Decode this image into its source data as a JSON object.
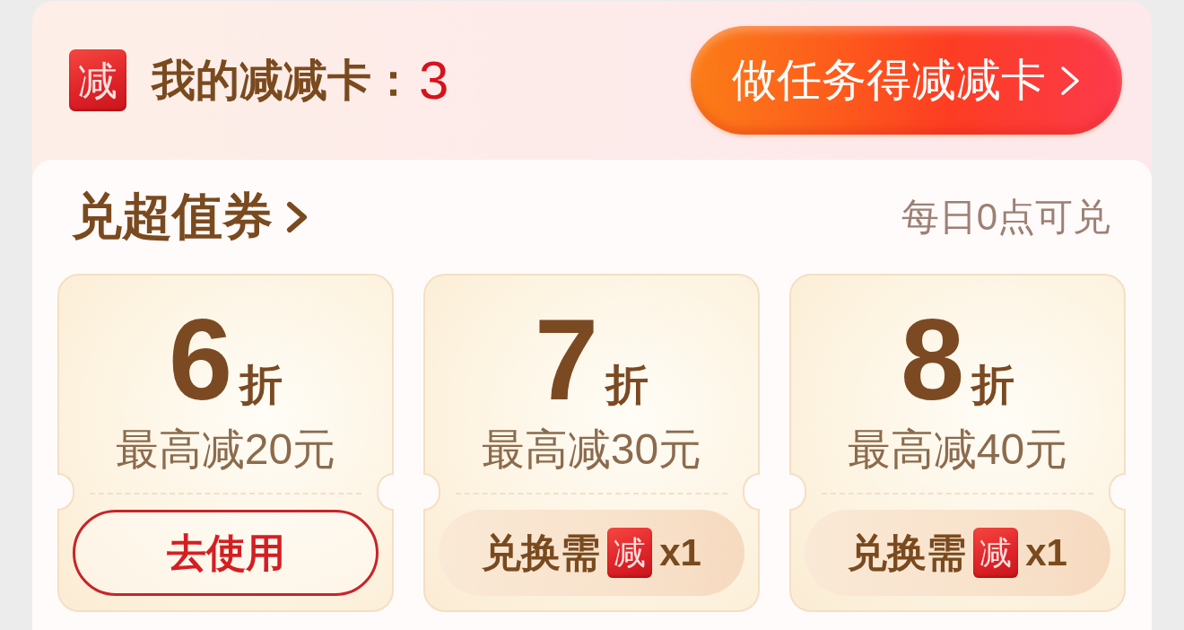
{
  "header": {
    "badge": "减",
    "title": "我的减减卡：",
    "count": "3",
    "task_button": "做任务得减减卡"
  },
  "coupon_section": {
    "title": "兑超值券",
    "note": "每日0点可兑",
    "coupons": [
      {
        "discount": "6",
        "unit": "折",
        "max_off": "最高减20元",
        "action": {
          "kind": "use",
          "label": "去使用"
        }
      },
      {
        "discount": "7",
        "unit": "折",
        "max_off": "最高减30元",
        "action": {
          "kind": "exchange",
          "label": "兑换需",
          "badge": "减",
          "quantity": "x1"
        }
      },
      {
        "discount": "8",
        "unit": "折",
        "max_off": "最高减40元",
        "action": {
          "kind": "exchange",
          "label": "兑换需",
          "badge": "减",
          "quantity": "x1"
        }
      }
    ]
  }
}
